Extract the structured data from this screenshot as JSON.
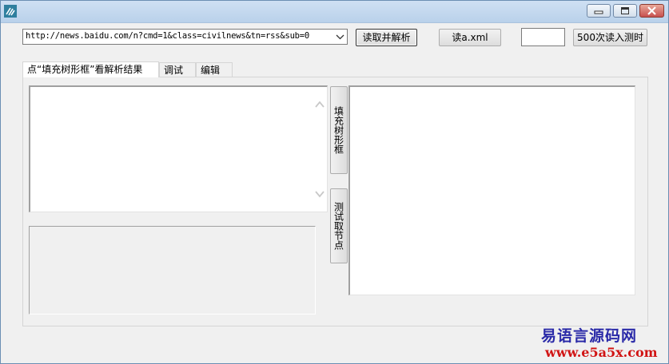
{
  "window": {
    "icon": "app-icon",
    "controls": [
      "minimize-icon",
      "maximize-icon",
      "close-icon"
    ]
  },
  "toolbar": {
    "url_value": "http://news.baidu.com/n?cmd=1&class=civilnews&tn=rss&sub=0",
    "parse_button": "读取并解析",
    "read_xml_button": "读a.xml",
    "count_input_value": "",
    "timing_button": "500次读入测时"
  },
  "tabs": [
    {
      "label": "点“填充树形框”看解析结果",
      "active": true
    },
    {
      "label": "调试",
      "active": false
    },
    {
      "label": "编辑",
      "active": false
    }
  ],
  "side_buttons": {
    "fill_tree": "填充树形框",
    "test_node": "测试取节点"
  },
  "watermark": {
    "title": "易语言源码网",
    "url": "www.e5a5x.com"
  },
  "colors": {
    "watermark_title": "#2a2aa8",
    "watermark_url": "#d11515",
    "titlebar": "#c4d9ef"
  }
}
